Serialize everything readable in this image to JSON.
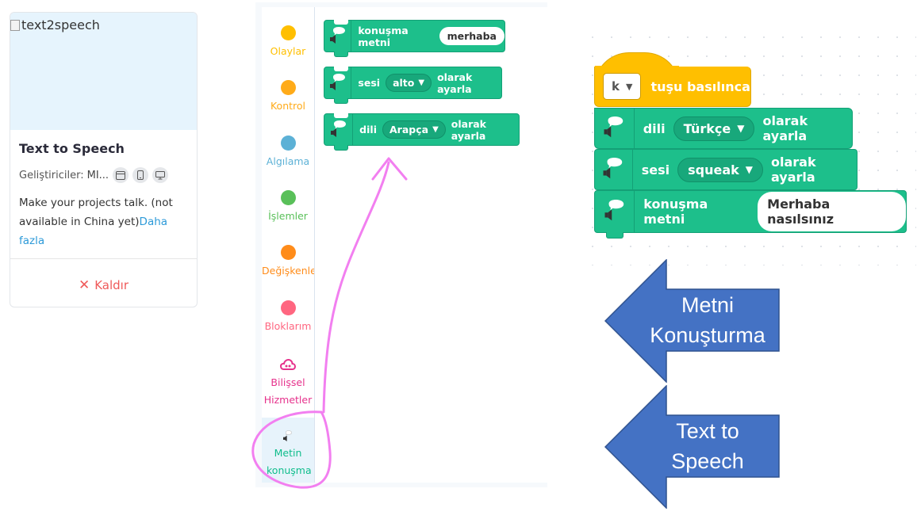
{
  "extension_card": {
    "image_alt": "text2speech",
    "title": "Text to Speech",
    "developers_label": "Geliştiriciler:",
    "developers_value": "MI...",
    "description": "Make your projects talk. (not available in China yet)",
    "more_link": "Daha fazla",
    "remove_label": "Kaldır"
  },
  "palette": {
    "categories": [
      {
        "label": "Olaylar",
        "color": "#ffbf00"
      },
      {
        "label": "Kontrol",
        "color": "#ffab19"
      },
      {
        "label": "Algılama",
        "color": "#5cb1d6"
      },
      {
        "label": "İşlemler",
        "color": "#59c059"
      },
      {
        "label": "Değişkenle",
        "color": "#ff8c1a"
      },
      {
        "label": "Bloklarım",
        "color": "#ff6680"
      },
      {
        "label": "Bilişsel Hizmetler",
        "color": "#e6328c"
      },
      {
        "label": "Metin konuşma",
        "color": "#0fbd8c"
      }
    ],
    "blocks": [
      {
        "text": "konuşma metni",
        "input": "merhaba"
      },
      {
        "text": "sesi",
        "dropdown": "alto",
        "suffix": "olarak ayarla"
      },
      {
        "text": "dili",
        "dropdown": "Arapça",
        "suffix": "olarak ayarla"
      }
    ]
  },
  "script": {
    "hat": {
      "key": "k",
      "label": "tuşu basılınca"
    },
    "blocks": [
      {
        "text": "dili",
        "dropdown": "Türkçe",
        "suffix": "olarak ayarla"
      },
      {
        "text": "sesi",
        "dropdown": "squeak",
        "suffix": "olarak ayarla"
      },
      {
        "text": "konuşma metni",
        "input": "Merhaba nasılsınız"
      }
    ]
  },
  "callouts": [
    {
      "line1": "Metni",
      "line2": "Konuşturma",
      "color": "#4472c4"
    },
    {
      "line1": "Text to",
      "line2": "Speech",
      "color": "#4472c4"
    }
  ],
  "colors": {
    "extension_green": "#1dbf8b",
    "event_yellow": "#ffbf00",
    "annotation_pink": "#f27ff0",
    "link_blue": "#2d9ad8",
    "remove_red": "#ef5a5a"
  }
}
